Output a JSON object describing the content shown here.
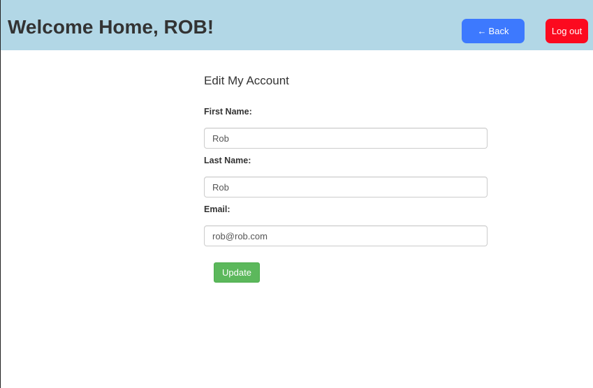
{
  "header": {
    "title": "Welcome Home, ROB!",
    "back_arrow": "←",
    "back_label": "Back",
    "logout_label": "Log out",
    "background_color": "#b2d7e6",
    "back_color": "#3d79fe",
    "logout_color": "#fc0a1f"
  },
  "form": {
    "title": "Edit My Account",
    "first_name": {
      "label": "First Name:",
      "value": "Rob"
    },
    "last_name": {
      "label": "Last Name:",
      "value": "Rob"
    },
    "email": {
      "label": "Email:",
      "value": "rob@rob.com"
    },
    "submit_label": "Update",
    "submit_color": "#5cb85c"
  }
}
